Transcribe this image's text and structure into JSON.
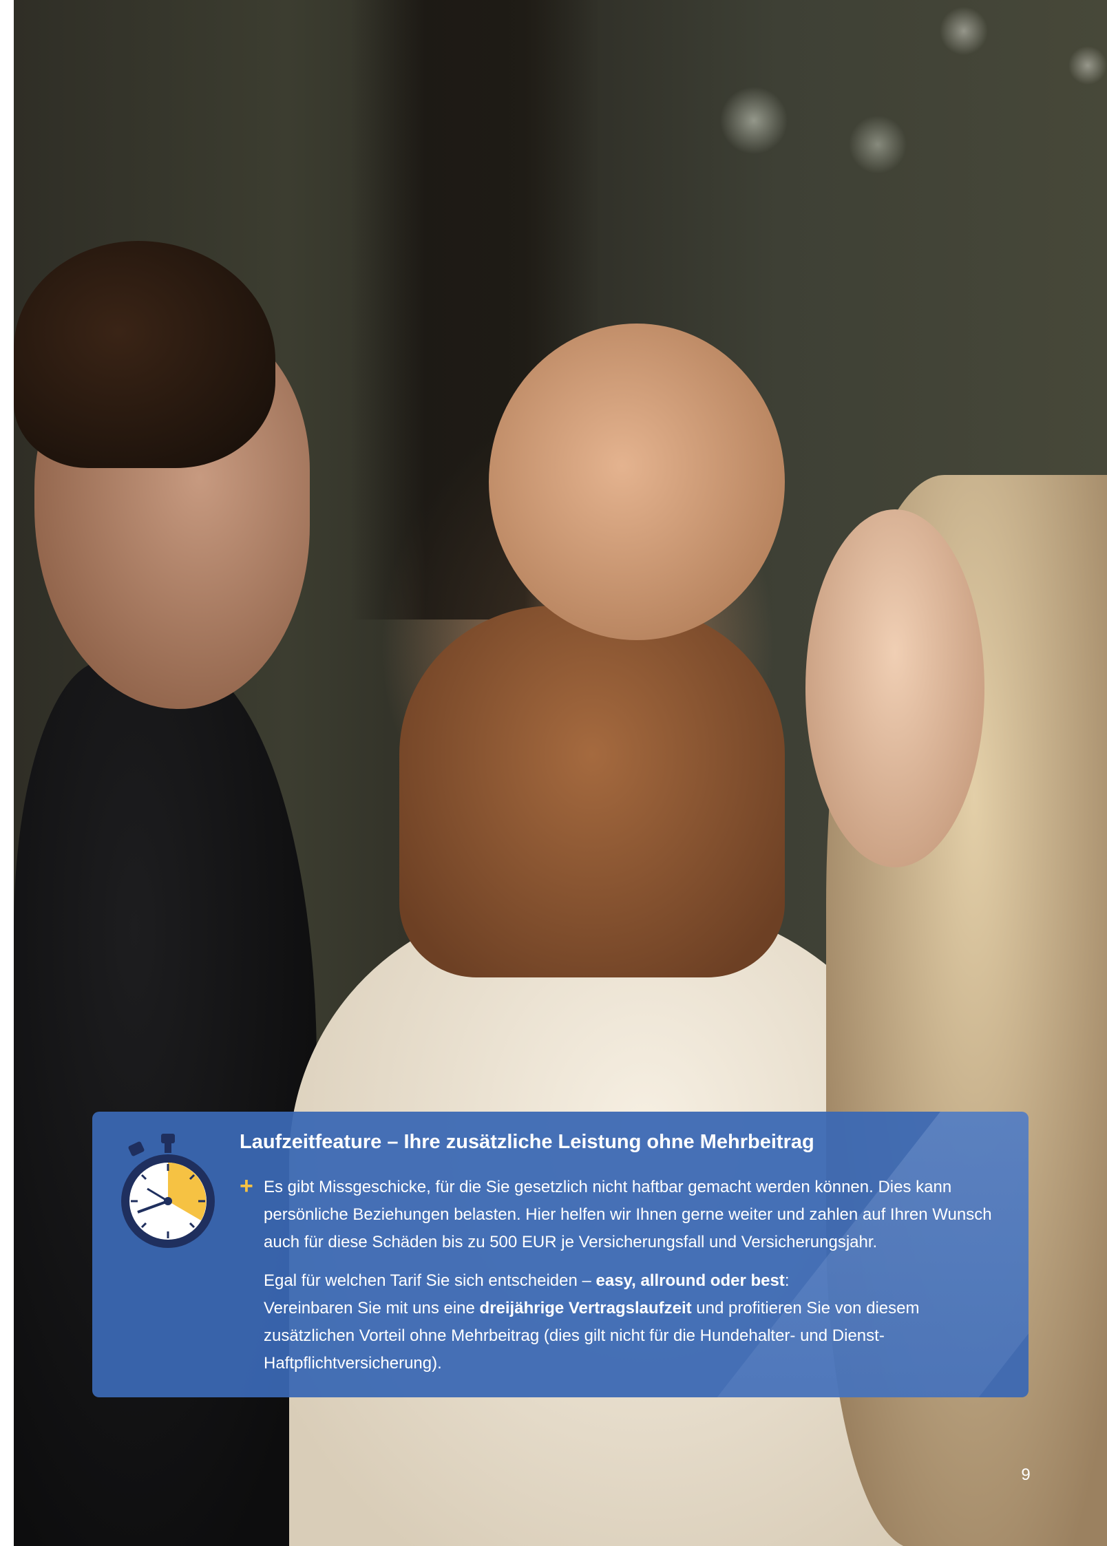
{
  "photo": {
    "description_icon": "family-photo"
  },
  "info_box": {
    "icon": "stopwatch-icon",
    "title": "Laufzeitfeature – Ihre zusätzliche Leistung ohne Mehrbeitrag",
    "bullet_symbol": "+",
    "paragraph1": "Es gibt Missgeschicke, für die Sie gesetzlich nicht haftbar gemacht werden können. Dies kann persönliche Beziehungen belasten. Hier helfen wir Ihnen gerne weiter und zahlen auf Ihren Wunsch auch für diese Schäden bis zu 500 EUR je Versicherungsfall und Versicherungsjahr.",
    "paragraph2": {
      "lead": "Egal für welchen Tarif Sie sich entscheiden – ",
      "tariffs": "easy, allround oder best",
      "lead_end": ":",
      "line2_start": "Vereinbaren Sie mit uns eine ",
      "duration": "dreijährige Vertragslaufzeit",
      "line2_end": " und profitieren Sie von diesem zusätzlichen Vorteil ohne Mehrbeitrag (dies gilt nicht für die Hundehalter- und Dienst-Haftpflichtversicherung)."
    }
  },
  "colors": {
    "box_background": "#3a68b4",
    "accent": "#f6c243",
    "stopwatch_dark": "#1f2f5e"
  },
  "page_number": "9"
}
